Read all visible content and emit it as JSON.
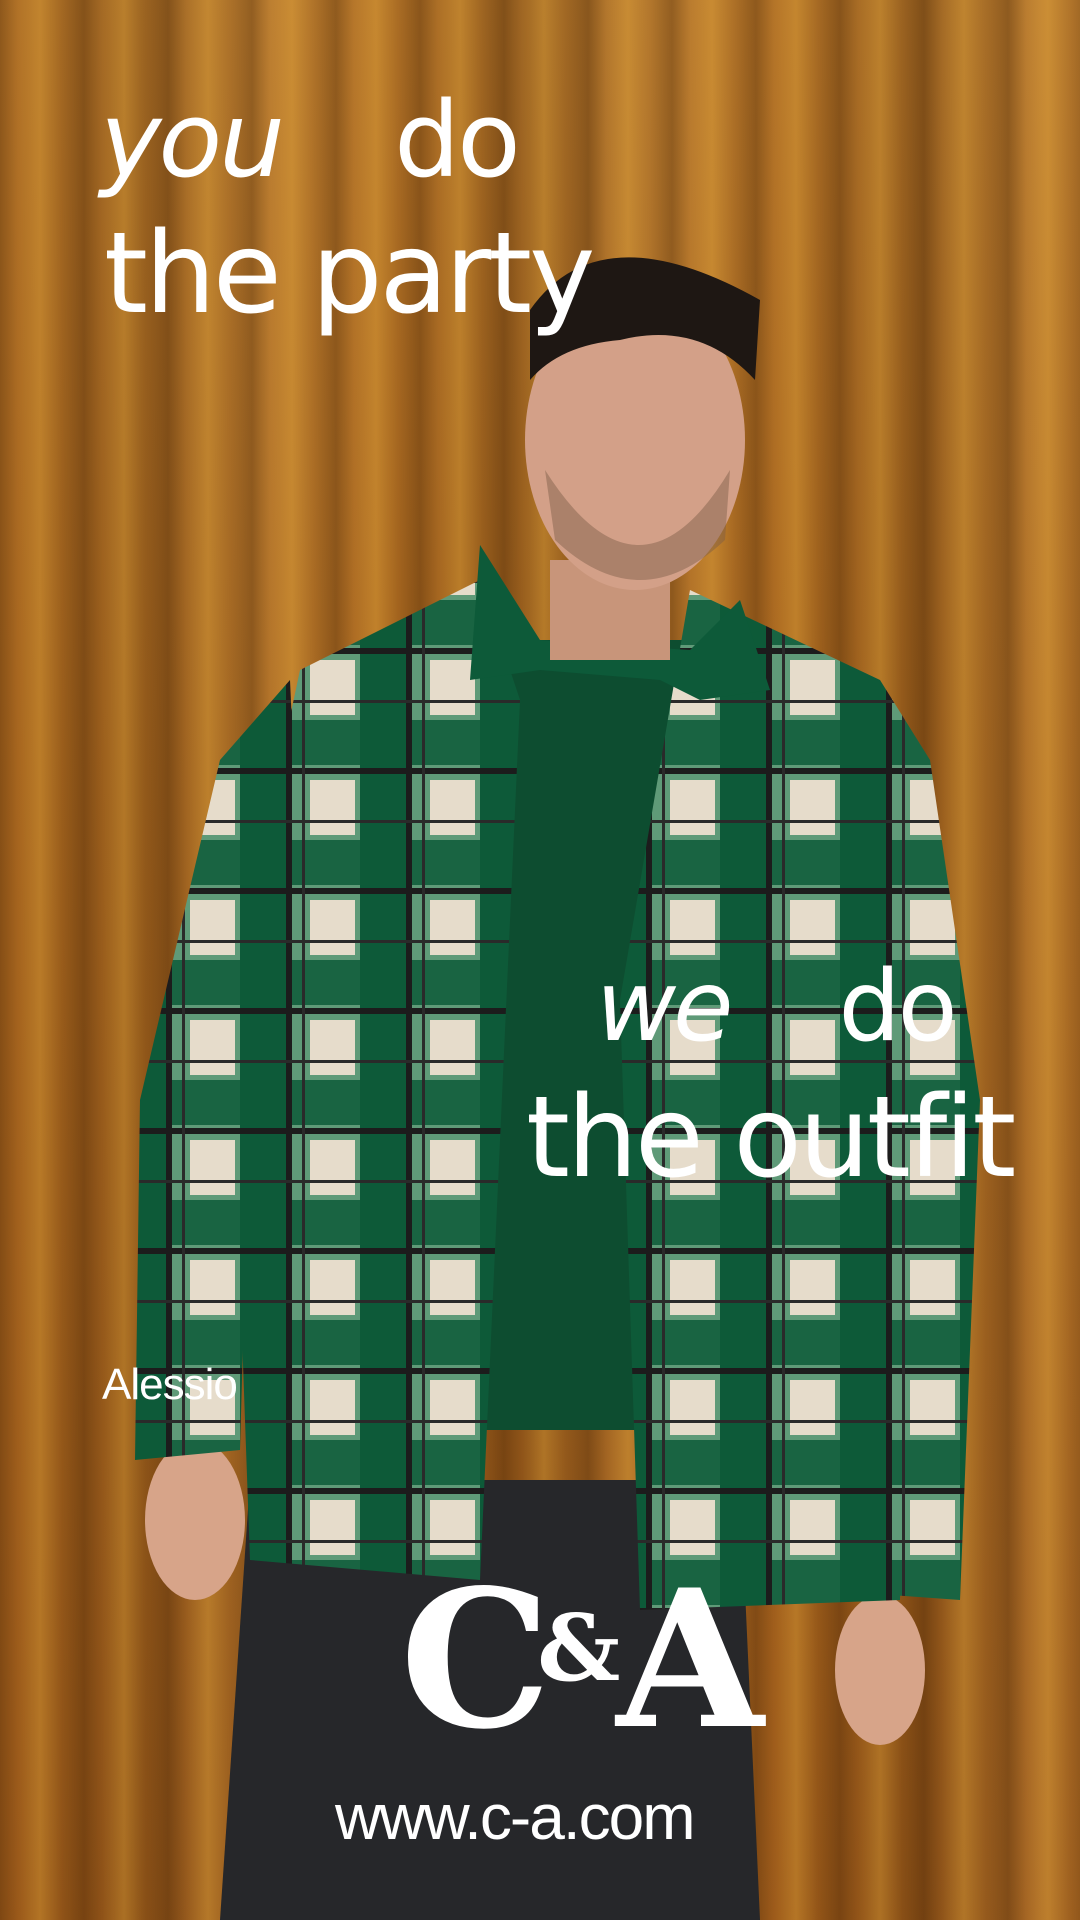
{
  "headline_top": {
    "line1_word1": "you",
    "line1_word2": "do",
    "line2": "the party"
  },
  "headline_bottom": {
    "line1_word1": "we",
    "line1_word2": "do",
    "line2": "the outfit"
  },
  "model_name": "Alessio",
  "brand": {
    "logo_text": "C&A",
    "url": "www.c-a.com"
  },
  "colors": {
    "curtain": "#a8651e",
    "text": "#ffffff",
    "shirt_green": "#0f5a3a",
    "shirt_cream": "#e6dccb"
  }
}
